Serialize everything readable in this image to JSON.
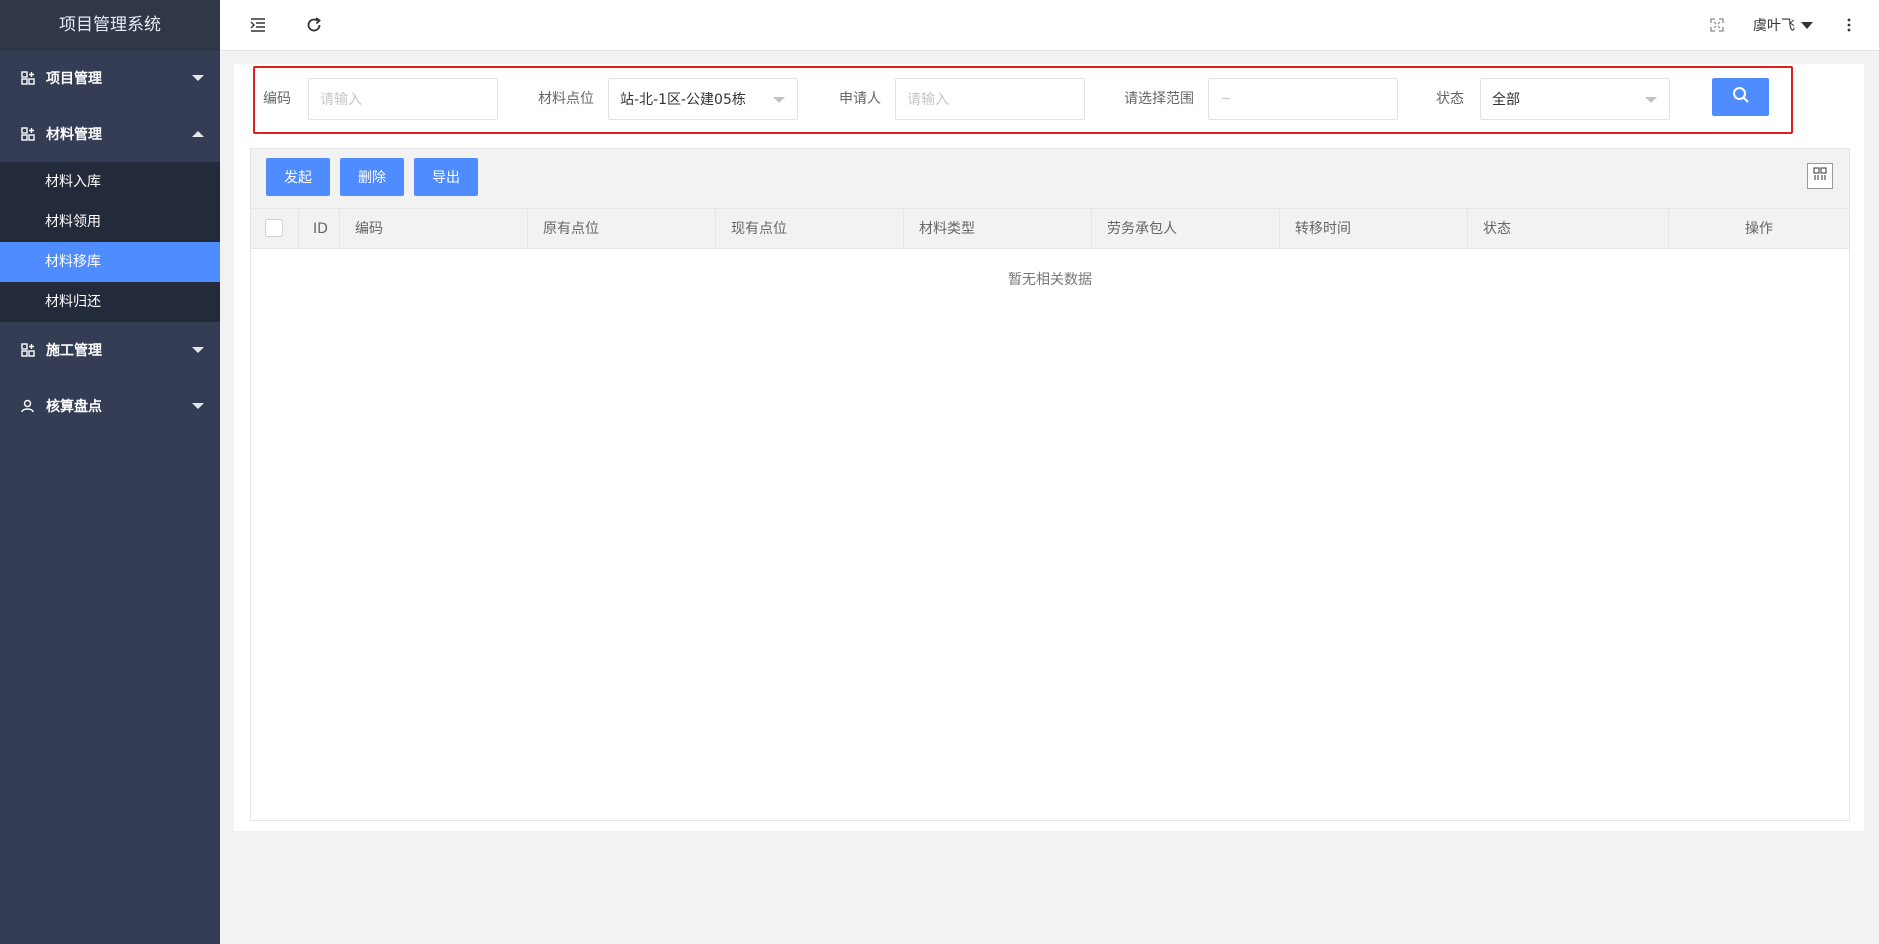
{
  "app": {
    "title": "项目管理系统"
  },
  "sidebar": {
    "groups": [
      {
        "label": "项目管理",
        "icon": "grid-plus-icon",
        "expanded": false
      },
      {
        "label": "材料管理",
        "icon": "grid-plus-icon",
        "expanded": true,
        "items": [
          "材料入库",
          "材料领用",
          "材料移库",
          "材料归还"
        ],
        "active_item": "材料移库"
      },
      {
        "label": "施工管理",
        "icon": "grid-plus-icon",
        "expanded": false
      },
      {
        "label": "核算盘点",
        "icon": "user-icon",
        "expanded": false
      }
    ]
  },
  "topbar": {
    "user_name": "虞叶飞",
    "icons": [
      "menu-collapse-icon",
      "refresh-icon",
      "fullscreen-icon",
      "more-vertical-icon"
    ]
  },
  "search": {
    "code_label": "编码",
    "code_placeholder": "请输入",
    "location_label": "材料点位",
    "location_value": "站-北-1区-公建05栋",
    "applicant_label": "申请人",
    "applicant_placeholder": "请输入",
    "range_label": "请选择范围",
    "range_placeholder": "~",
    "status_label": "状态",
    "status_value": "全部"
  },
  "toolbar": {
    "initiate_label": "发起",
    "delete_label": "删除",
    "export_label": "导出"
  },
  "table": {
    "columns": [
      "ID",
      "编码",
      "原有点位",
      "现有点位",
      "材料类型",
      "劳务承包人",
      "转移时间",
      "状态",
      "操作"
    ],
    "empty_text": "暂无相关数据"
  },
  "colors": {
    "primary": "#4e8cff",
    "sidebar_bg": "#343d54",
    "highlight_border": "#e0201d"
  }
}
